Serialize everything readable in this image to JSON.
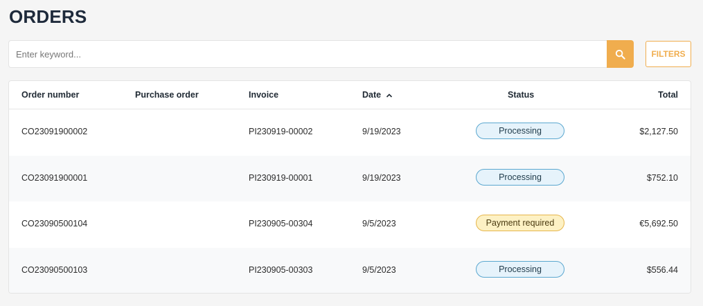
{
  "page": {
    "title": "ORDERS"
  },
  "search": {
    "placeholder": "Enter keyword...",
    "value": ""
  },
  "filters": {
    "label": "FILTERS"
  },
  "colors": {
    "accent": "#f0ad4e",
    "processing": "#5aa7cf",
    "payment_required": "#e6b54a"
  },
  "table": {
    "headers": {
      "order_number": "Order number",
      "purchase_order": "Purchase order",
      "invoice": "Invoice",
      "date": "Date",
      "status": "Status",
      "total": "Total"
    },
    "sort": {
      "column": "date",
      "direction": "ascending"
    },
    "rows": [
      {
        "order_number": "CO23091900002",
        "purchase_order": "",
        "invoice": "PI230919-00002",
        "date": "9/19/2023",
        "status": "Processing",
        "total": "$2,127.50"
      },
      {
        "order_number": "CO23091900001",
        "purchase_order": "",
        "invoice": "PI230919-00001",
        "date": "9/19/2023",
        "status": "Processing",
        "total": "$752.10"
      },
      {
        "order_number": "CO23090500104",
        "purchase_order": "",
        "invoice": "PI230905-00304",
        "date": "9/5/2023",
        "status": "Payment required",
        "total": "€5,692.50"
      },
      {
        "order_number": "CO23090500103",
        "purchase_order": "",
        "invoice": "PI230905-00303",
        "date": "9/5/2023",
        "status": "Processing",
        "total": "$556.44"
      }
    ]
  }
}
